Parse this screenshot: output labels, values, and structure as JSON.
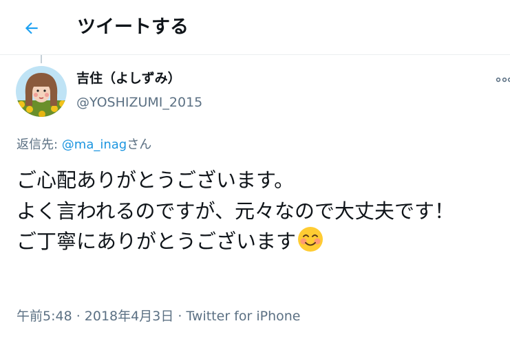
{
  "header": {
    "back_icon": "arrow-left-icon",
    "title": "ツイートする",
    "accent_color": "#1da1f2"
  },
  "tweet": {
    "author": {
      "display_name": "吉住（よしずみ）",
      "handle": "@YOSHIZUMI_2015"
    },
    "reply_to": {
      "prefix": "返信先: ",
      "mention": "@ma_inag",
      "suffix": "さん"
    },
    "text": "ご心配ありがとうございます。\nよく言われるのですが、元々なので大丈夫です！\nご丁寧にありがとうございます",
    "emoji": "smiling-face-emoji",
    "time": "午前5:48",
    "separator": " · ",
    "date": "2018年4月3日",
    "client": "Twitter for iPhone"
  },
  "colors": {
    "text": "#0f1419",
    "secondary": "#5b7083",
    "link": "#1b95e0"
  }
}
